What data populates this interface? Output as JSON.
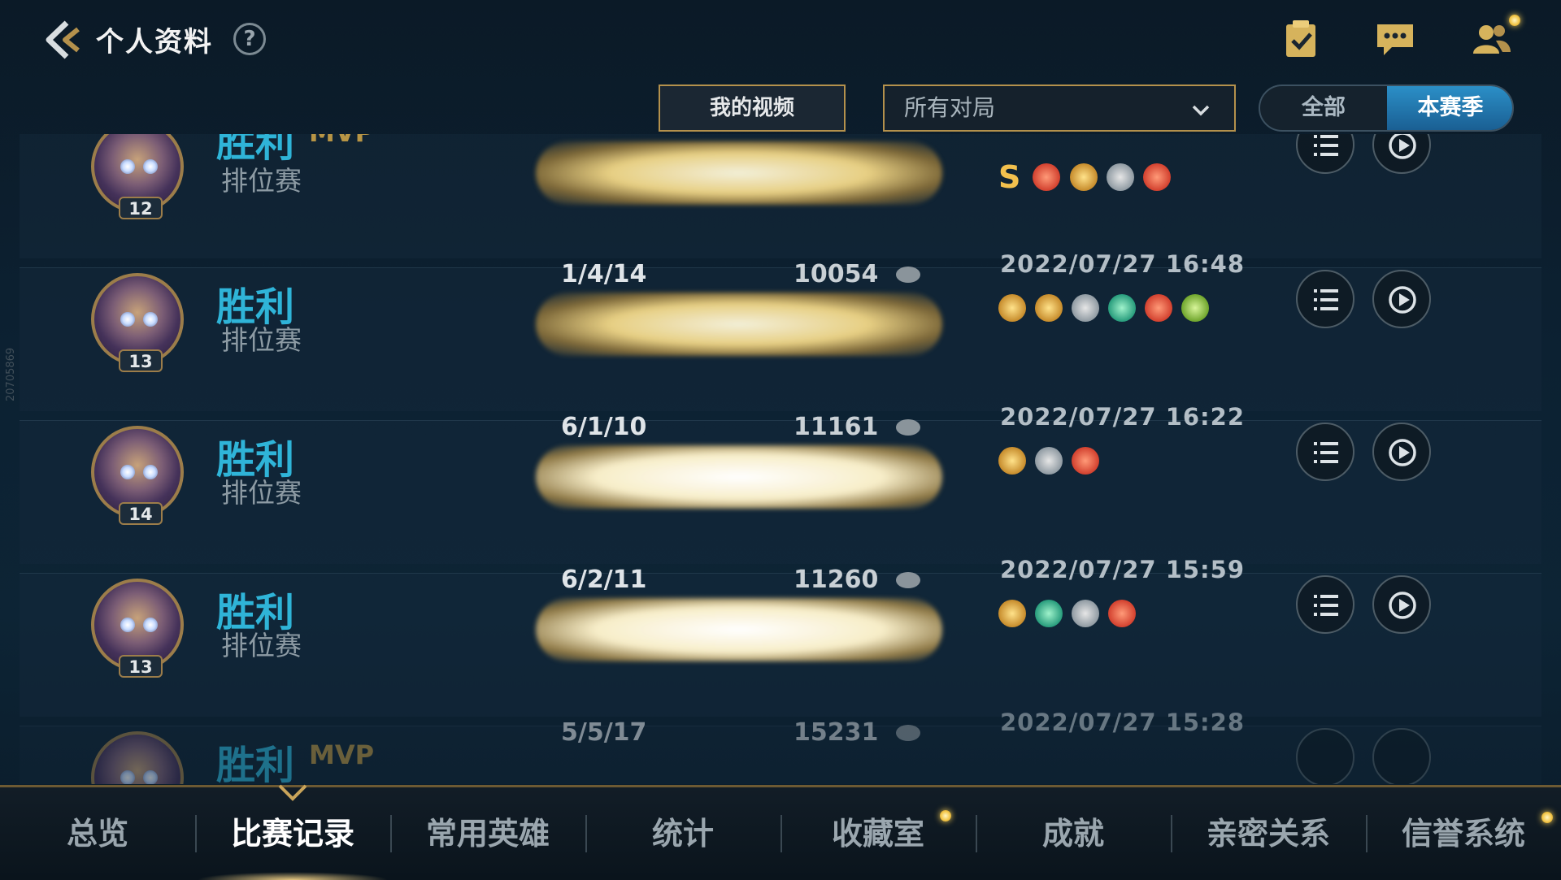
{
  "header": {
    "title": "个人资料",
    "help_glyph": "?",
    "icons": [
      "back-arrow-icon",
      "checklist-icon",
      "chat-icon",
      "friends-icon"
    ]
  },
  "filters": {
    "my_videos": "我的视频",
    "match_filter": "所有对局",
    "segment_all": "全部",
    "segment_season": "本赛季",
    "selected_segment": "本赛季"
  },
  "side_id": "20705869",
  "matches": [
    {
      "result": "胜利",
      "mvp": "MVP",
      "mode": "排位赛",
      "level": "12",
      "kda": "",
      "score": "",
      "date": "",
      "grade": "S"
    },
    {
      "result": "胜利",
      "mvp": "",
      "mode": "排位赛",
      "level": "13",
      "kda": "1/4/14",
      "score": "10054",
      "date": "2022/07/27 16:48",
      "grade": ""
    },
    {
      "result": "胜利",
      "mvp": "",
      "mode": "排位赛",
      "level": "14",
      "kda": "6/1/10",
      "score": "11161",
      "date": "2022/07/27 16:22",
      "grade": ""
    },
    {
      "result": "胜利",
      "mvp": "",
      "mode": "排位赛",
      "level": "13",
      "kda": "6/2/11",
      "score": "11260",
      "date": "2022/07/27 15:59",
      "grade": ""
    },
    {
      "result": "胜利",
      "mvp": "MVP",
      "mode": "",
      "level": "",
      "kda": "5/5/17",
      "score": "15231",
      "date": "2022/07/27 15:28",
      "grade": ""
    }
  ],
  "bottom_tabs": [
    "总览",
    "比赛记录",
    "常用英雄",
    "统计",
    "收藏室",
    "成就",
    "亲密关系",
    "信誉系统"
  ],
  "active_tab": "比赛记录",
  "colors": {
    "win": "#2fb4d8",
    "accent_gold": "#b4914c",
    "active_segment": "#2b8fc7"
  }
}
